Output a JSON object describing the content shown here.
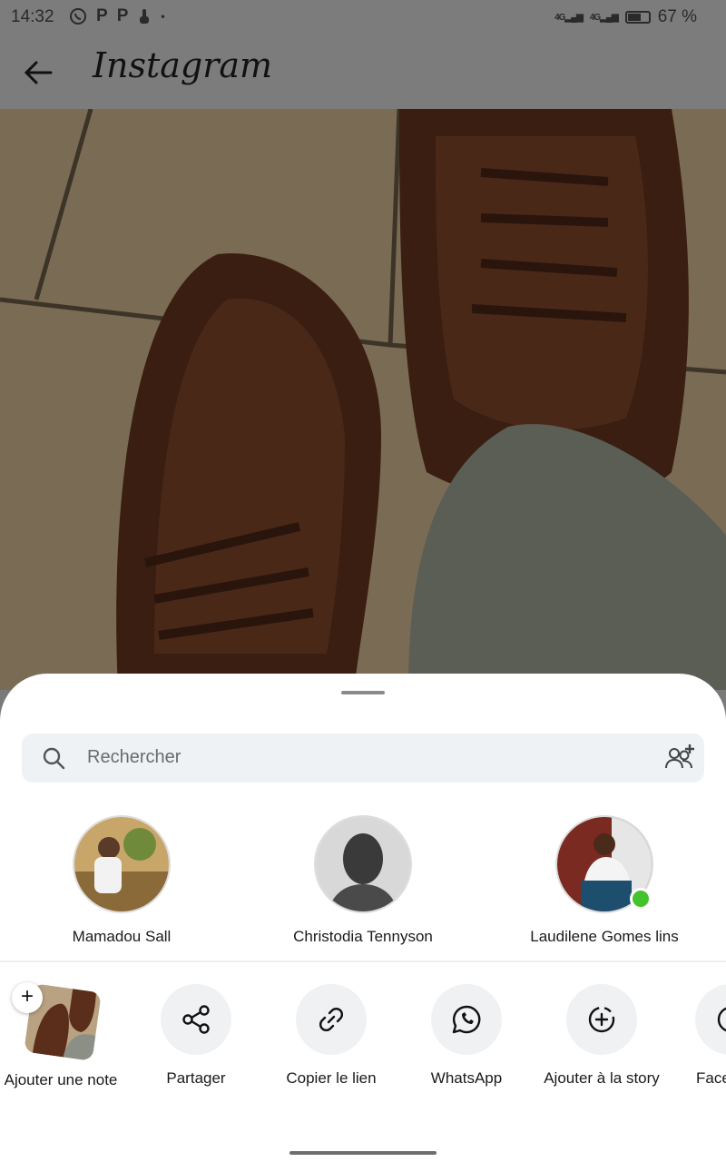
{
  "status": {
    "time": "14:32",
    "left_icons": [
      "whatsapp-icon",
      "p-icon",
      "p-icon",
      "touch-icon",
      "dot"
    ],
    "signal1": "4G",
    "signal2": "4G",
    "battery": "67 %"
  },
  "header": {
    "brand": "Instagram"
  },
  "search": {
    "placeholder": "Rechercher"
  },
  "contacts": [
    {
      "name": "Mamadou Sall",
      "online": false
    },
    {
      "name": "Christodia Tennyson",
      "online": false
    },
    {
      "name": "Laudilene Gomes lins",
      "online": true
    }
  ],
  "actions": [
    {
      "label": "Ajouter une note",
      "icon": "note-thumbnail"
    },
    {
      "label": "Partager",
      "icon": "share-icon"
    },
    {
      "label": "Copier le lien",
      "icon": "link-icon"
    },
    {
      "label": "WhatsApp",
      "icon": "whatsapp-icon"
    },
    {
      "label": "Ajouter à la story",
      "icon": "add-story-icon"
    },
    {
      "label": "Face",
      "icon": "facebook-icon"
    }
  ],
  "colors": {
    "online": "#44c32c",
    "sheet": "#ffffff",
    "field": "#eff2f5"
  }
}
